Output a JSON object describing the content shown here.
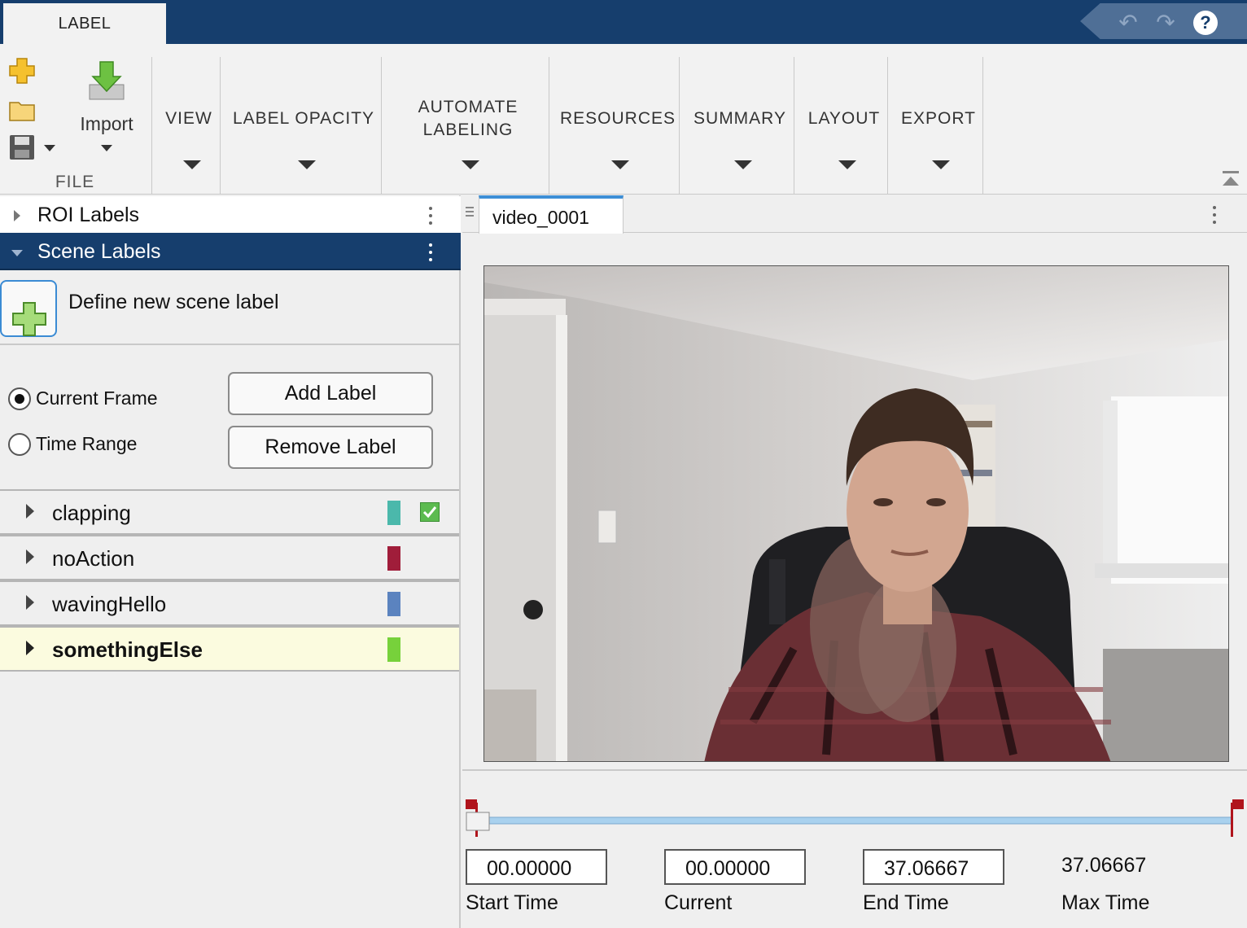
{
  "toolstrip": {
    "tab_label": "LABEL",
    "undo_icon": "undo-icon",
    "redo_icon": "redo-icon",
    "help_icon": "help-icon",
    "help_glyph": "?"
  },
  "ribbon": {
    "file_group_label": "FILE",
    "import_label": "Import",
    "sections": {
      "view": "VIEW",
      "label_opacity": "LABEL OPACITY",
      "automate_line1": "AUTOMATE",
      "automate_line2": "LABELING",
      "resources": "RESOURCES",
      "summary": "SUMMARY",
      "layout": "LAYOUT",
      "export": "EXPORT"
    }
  },
  "left_panel": {
    "roi_header": "ROI Labels",
    "scene_header": "Scene Labels",
    "define_label": "Define new scene label",
    "radio_current": "Current Frame",
    "radio_range": "Time Range",
    "add_button": "Add Label",
    "remove_button": "Remove Label",
    "labels": [
      {
        "name": "clapping",
        "color": "#4bb8ab",
        "checked": true
      },
      {
        "name": "noAction",
        "color": "#a01d3a",
        "checked": false
      },
      {
        "name": "wavingHello",
        "color": "#5b83bf",
        "checked": false
      },
      {
        "name": "somethingElse",
        "color": "#77d13b",
        "checked": false,
        "selected": true
      }
    ]
  },
  "viewer": {
    "tab_title": "video_0001"
  },
  "playback": {
    "start_value": "00.00000",
    "current_value": "00.00000",
    "end_value": "37.06667",
    "max_value": "37.06667",
    "start_label": "Start Time",
    "current_label": "Current",
    "end_label": "End Time",
    "max_label": "Max Time"
  },
  "colors": {
    "topbar": "#163e6d",
    "scene_header": "#163e6d",
    "selected_row": "#fbfbdf",
    "marker_red": "#b0141c",
    "slider_track": "#a9d1ee"
  }
}
